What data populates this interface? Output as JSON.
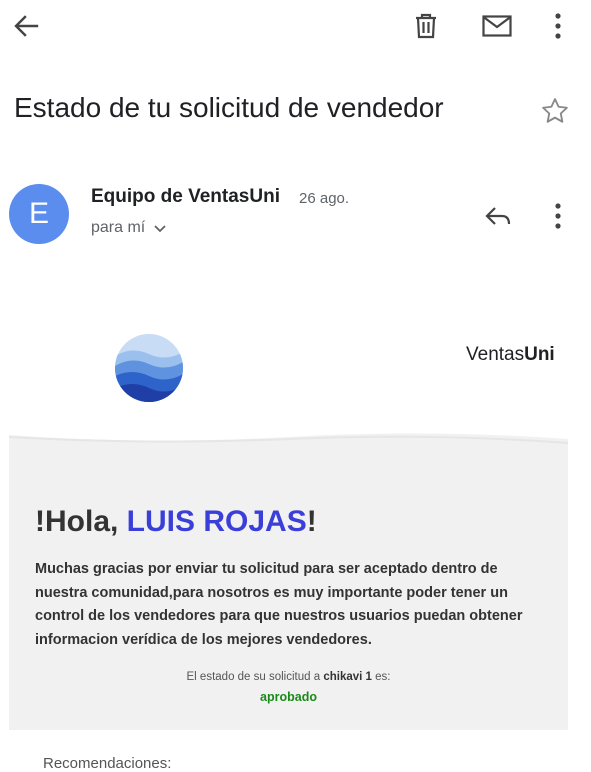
{
  "toolbar": {
    "back_icon": "arrow-left-icon",
    "delete_icon": "trash-icon",
    "mail_icon": "envelope-icon",
    "more_icon": "more-vert-icon"
  },
  "email": {
    "subject": "Estado de tu solicitud de vendedor",
    "sender_initial": "E",
    "sender": "Equipo de VentasUni",
    "date": "26 ago.",
    "recipient": "para mí"
  },
  "content": {
    "brand_prefix": "Ventas",
    "brand_bold": "Uni",
    "greeting_prefix": "!Hola, ",
    "greeting_name": "LUIS ROJAS",
    "greeting_suffix": "!",
    "paragraph": "Muchas gracias por enviar tu solicitud para ser aceptado dentro de nuestra comunidad,para nosotros es muy importante poder tener un control de los vendedores para que nuestros usuarios puedan obtener informacion verídica de los mejores vendedores.",
    "status_prefix": "El estado de su solicitud a ",
    "status_item": "chikavi 1",
    "status_suffix": " es:",
    "status_value": "aprobado",
    "recommendations": "Recomendaciones:"
  },
  "colors": {
    "avatar": "#5b8def",
    "name_accent": "#3b3fd9",
    "status_ok": "#1a8a1a"
  }
}
